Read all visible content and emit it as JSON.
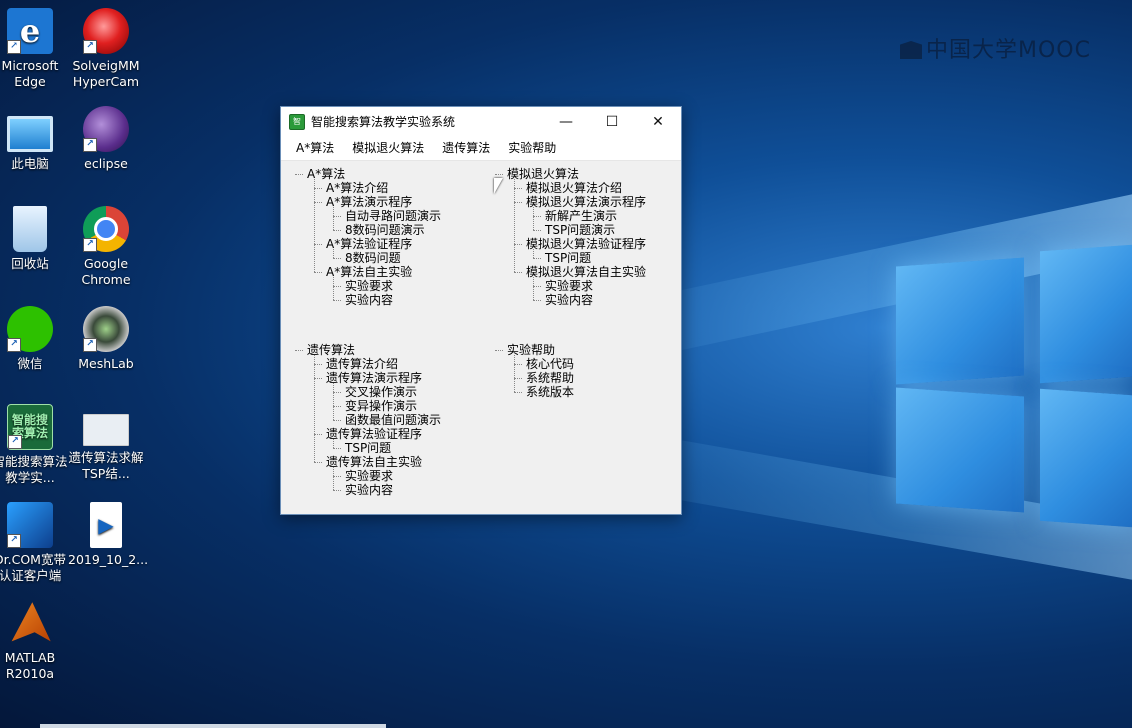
{
  "desktop": {
    "watermark": "中国大学MOOC",
    "icons": [
      {
        "label": "Microsoft Edge",
        "glyph": "e"
      },
      {
        "label": "SolveigMM HyperCam"
      },
      {
        "label": "此电脑"
      },
      {
        "label": "eclipse"
      },
      {
        "label": "回收站"
      },
      {
        "label": "Google Chrome"
      },
      {
        "label": "微信"
      },
      {
        "label": "MeshLab"
      },
      {
        "label": "智能搜索算法教学实...",
        "glyph": "智能搜索算法"
      },
      {
        "label": "遗传算法求解TSP结..."
      },
      {
        "label": "Dr.COM宽带认证客户端"
      },
      {
        "label": "2019_10_2..."
      },
      {
        "label": "MATLAB R2010a"
      }
    ]
  },
  "window": {
    "title": "智能搜索算法教学实验系统",
    "app_icon_text": "智",
    "controls": {
      "minimize": "—",
      "maximize": "☐",
      "close": "✕"
    },
    "menu": [
      "A*算法",
      "模拟退火算法",
      "遗传算法",
      "实验帮助"
    ],
    "trees": {
      "astar": {
        "root": "A*算法",
        "items": [
          {
            "label": "A*算法介绍",
            "level": 1
          },
          {
            "label": "A*算法演示程序",
            "level": 1
          },
          {
            "label": "自动寻路问题演示",
            "level": 2
          },
          {
            "label": "8数码问题演示",
            "level": 2
          },
          {
            "label": "A*算法验证程序",
            "level": 1
          },
          {
            "label": "8数码问题",
            "level": 2
          },
          {
            "label": "A*算法自主实验",
            "level": 1
          },
          {
            "label": "实验要求",
            "level": 2
          },
          {
            "label": "实验内容",
            "level": 2
          }
        ]
      },
      "sa": {
        "root": "模拟退火算法",
        "items": [
          {
            "label": "模拟退火算法介绍",
            "level": 1
          },
          {
            "label": "模拟退火算法演示程序",
            "level": 1
          },
          {
            "label": "新解产生演示",
            "level": 2
          },
          {
            "label": "TSP问题演示",
            "level": 2
          },
          {
            "label": "模拟退火算法验证程序",
            "level": 1
          },
          {
            "label": "TSP问题",
            "level": 2
          },
          {
            "label": "模拟退火算法自主实验",
            "level": 1
          },
          {
            "label": "实验要求",
            "level": 2
          },
          {
            "label": "实验内容",
            "level": 2
          }
        ]
      },
      "ga": {
        "root": "遗传算法",
        "items": [
          {
            "label": "遗传算法介绍",
            "level": 1
          },
          {
            "label": "遗传算法演示程序",
            "level": 1
          },
          {
            "label": "交叉操作演示",
            "level": 2
          },
          {
            "label": "变异操作演示",
            "level": 2
          },
          {
            "label": "函数最值问题演示",
            "level": 2
          },
          {
            "label": "遗传算法验证程序",
            "level": 1
          },
          {
            "label": "TSP问题",
            "level": 2
          },
          {
            "label": "遗传算法自主实验",
            "level": 1
          },
          {
            "label": "实验要求",
            "level": 2
          },
          {
            "label": "实验内容",
            "level": 2
          }
        ]
      },
      "help": {
        "root": "实验帮助",
        "items": [
          {
            "label": "核心代码",
            "level": 1
          },
          {
            "label": "系统帮助",
            "level": 1
          },
          {
            "label": "系统版本",
            "level": 1
          }
        ]
      }
    }
  }
}
